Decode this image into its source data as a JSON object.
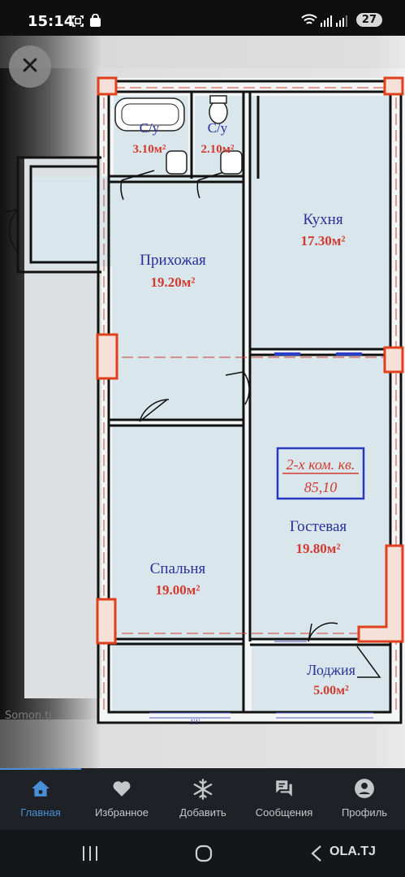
{
  "status_bar": {
    "time": "15:14",
    "notification_count": "27"
  },
  "viewer": {
    "close_label": "✕",
    "watermark": "Somon.tj"
  },
  "plan": {
    "rooms": [
      {
        "name": "С/у",
        "area": "3.10м²"
      },
      {
        "name": "С/у",
        "area": "2.10м²"
      },
      {
        "name": "Кухня",
        "area": "17.30м²"
      },
      {
        "name": "Прихожая",
        "area": "19.20м²"
      },
      {
        "name": "Гостевая",
        "area": "19.80м²"
      },
      {
        "name": "Спальня",
        "area": "19.00м²"
      },
      {
        "name": "Лоджия",
        "area": "5.00м²"
      }
    ],
    "apartment_type": "2-х ком. кв.",
    "total_area": "85,10",
    "window_mark": "1'1'"
  },
  "nav": {
    "items": [
      {
        "label": "Главная",
        "icon": "home-icon",
        "active": true
      },
      {
        "label": "Избранное",
        "icon": "heart-icon",
        "active": false
      },
      {
        "label": "Добавить",
        "icon": "snowflake-icon",
        "active": false
      },
      {
        "label": "Сообщения",
        "icon": "chat-icon",
        "active": false
      },
      {
        "label": "Профиль",
        "icon": "profile-icon",
        "active": false
      }
    ],
    "active_color": "#4a90d9"
  },
  "system_nav": {
    "brand": "OLA.TJ"
  }
}
